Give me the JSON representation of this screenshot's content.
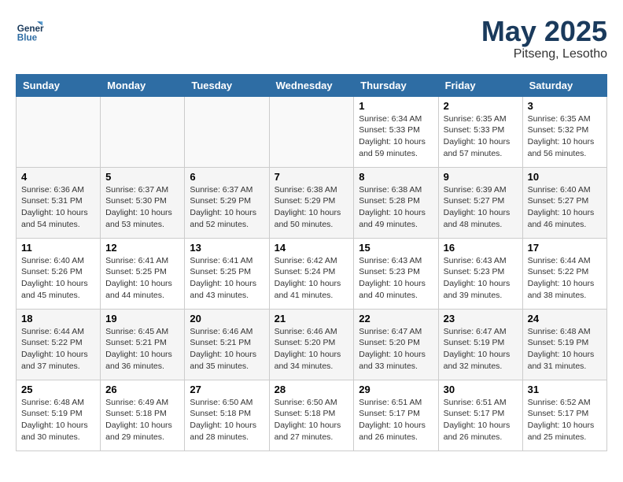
{
  "logo": {
    "text_top": "General",
    "text_bottom": "Blue"
  },
  "header": {
    "month_year": "May 2025",
    "location": "Pitseng, Lesotho"
  },
  "days_of_week": [
    "Sunday",
    "Monday",
    "Tuesday",
    "Wednesday",
    "Thursday",
    "Friday",
    "Saturday"
  ],
  "weeks": [
    [
      {
        "num": "",
        "sunrise": "",
        "sunset": "",
        "daylight": ""
      },
      {
        "num": "",
        "sunrise": "",
        "sunset": "",
        "daylight": ""
      },
      {
        "num": "",
        "sunrise": "",
        "sunset": "",
        "daylight": ""
      },
      {
        "num": "",
        "sunrise": "",
        "sunset": "",
        "daylight": ""
      },
      {
        "num": "1",
        "sunrise": "Sunrise: 6:34 AM",
        "sunset": "Sunset: 5:33 PM",
        "daylight": "Daylight: 10 hours and 59 minutes."
      },
      {
        "num": "2",
        "sunrise": "Sunrise: 6:35 AM",
        "sunset": "Sunset: 5:33 PM",
        "daylight": "Daylight: 10 hours and 57 minutes."
      },
      {
        "num": "3",
        "sunrise": "Sunrise: 6:35 AM",
        "sunset": "Sunset: 5:32 PM",
        "daylight": "Daylight: 10 hours and 56 minutes."
      }
    ],
    [
      {
        "num": "4",
        "sunrise": "Sunrise: 6:36 AM",
        "sunset": "Sunset: 5:31 PM",
        "daylight": "Daylight: 10 hours and 54 minutes."
      },
      {
        "num": "5",
        "sunrise": "Sunrise: 6:37 AM",
        "sunset": "Sunset: 5:30 PM",
        "daylight": "Daylight: 10 hours and 53 minutes."
      },
      {
        "num": "6",
        "sunrise": "Sunrise: 6:37 AM",
        "sunset": "Sunset: 5:29 PM",
        "daylight": "Daylight: 10 hours and 52 minutes."
      },
      {
        "num": "7",
        "sunrise": "Sunrise: 6:38 AM",
        "sunset": "Sunset: 5:29 PM",
        "daylight": "Daylight: 10 hours and 50 minutes."
      },
      {
        "num": "8",
        "sunrise": "Sunrise: 6:38 AM",
        "sunset": "Sunset: 5:28 PM",
        "daylight": "Daylight: 10 hours and 49 minutes."
      },
      {
        "num": "9",
        "sunrise": "Sunrise: 6:39 AM",
        "sunset": "Sunset: 5:27 PM",
        "daylight": "Daylight: 10 hours and 48 minutes."
      },
      {
        "num": "10",
        "sunrise": "Sunrise: 6:40 AM",
        "sunset": "Sunset: 5:27 PM",
        "daylight": "Daylight: 10 hours and 46 minutes."
      }
    ],
    [
      {
        "num": "11",
        "sunrise": "Sunrise: 6:40 AM",
        "sunset": "Sunset: 5:26 PM",
        "daylight": "Daylight: 10 hours and 45 minutes."
      },
      {
        "num": "12",
        "sunrise": "Sunrise: 6:41 AM",
        "sunset": "Sunset: 5:25 PM",
        "daylight": "Daylight: 10 hours and 44 minutes."
      },
      {
        "num": "13",
        "sunrise": "Sunrise: 6:41 AM",
        "sunset": "Sunset: 5:25 PM",
        "daylight": "Daylight: 10 hours and 43 minutes."
      },
      {
        "num": "14",
        "sunrise": "Sunrise: 6:42 AM",
        "sunset": "Sunset: 5:24 PM",
        "daylight": "Daylight: 10 hours and 41 minutes."
      },
      {
        "num": "15",
        "sunrise": "Sunrise: 6:43 AM",
        "sunset": "Sunset: 5:23 PM",
        "daylight": "Daylight: 10 hours and 40 minutes."
      },
      {
        "num": "16",
        "sunrise": "Sunrise: 6:43 AM",
        "sunset": "Sunset: 5:23 PM",
        "daylight": "Daylight: 10 hours and 39 minutes."
      },
      {
        "num": "17",
        "sunrise": "Sunrise: 6:44 AM",
        "sunset": "Sunset: 5:22 PM",
        "daylight": "Daylight: 10 hours and 38 minutes."
      }
    ],
    [
      {
        "num": "18",
        "sunrise": "Sunrise: 6:44 AM",
        "sunset": "Sunset: 5:22 PM",
        "daylight": "Daylight: 10 hours and 37 minutes."
      },
      {
        "num": "19",
        "sunrise": "Sunrise: 6:45 AM",
        "sunset": "Sunset: 5:21 PM",
        "daylight": "Daylight: 10 hours and 36 minutes."
      },
      {
        "num": "20",
        "sunrise": "Sunrise: 6:46 AM",
        "sunset": "Sunset: 5:21 PM",
        "daylight": "Daylight: 10 hours and 35 minutes."
      },
      {
        "num": "21",
        "sunrise": "Sunrise: 6:46 AM",
        "sunset": "Sunset: 5:20 PM",
        "daylight": "Daylight: 10 hours and 34 minutes."
      },
      {
        "num": "22",
        "sunrise": "Sunrise: 6:47 AM",
        "sunset": "Sunset: 5:20 PM",
        "daylight": "Daylight: 10 hours and 33 minutes."
      },
      {
        "num": "23",
        "sunrise": "Sunrise: 6:47 AM",
        "sunset": "Sunset: 5:19 PM",
        "daylight": "Daylight: 10 hours and 32 minutes."
      },
      {
        "num": "24",
        "sunrise": "Sunrise: 6:48 AM",
        "sunset": "Sunset: 5:19 PM",
        "daylight": "Daylight: 10 hours and 31 minutes."
      }
    ],
    [
      {
        "num": "25",
        "sunrise": "Sunrise: 6:48 AM",
        "sunset": "Sunset: 5:19 PM",
        "daylight": "Daylight: 10 hours and 30 minutes."
      },
      {
        "num": "26",
        "sunrise": "Sunrise: 6:49 AM",
        "sunset": "Sunset: 5:18 PM",
        "daylight": "Daylight: 10 hours and 29 minutes."
      },
      {
        "num": "27",
        "sunrise": "Sunrise: 6:50 AM",
        "sunset": "Sunset: 5:18 PM",
        "daylight": "Daylight: 10 hours and 28 minutes."
      },
      {
        "num": "28",
        "sunrise": "Sunrise: 6:50 AM",
        "sunset": "Sunset: 5:18 PM",
        "daylight": "Daylight: 10 hours and 27 minutes."
      },
      {
        "num": "29",
        "sunrise": "Sunrise: 6:51 AM",
        "sunset": "Sunset: 5:17 PM",
        "daylight": "Daylight: 10 hours and 26 minutes."
      },
      {
        "num": "30",
        "sunrise": "Sunrise: 6:51 AM",
        "sunset": "Sunset: 5:17 PM",
        "daylight": "Daylight: 10 hours and 26 minutes."
      },
      {
        "num": "31",
        "sunrise": "Sunrise: 6:52 AM",
        "sunset": "Sunset: 5:17 PM",
        "daylight": "Daylight: 10 hours and 25 minutes."
      }
    ]
  ]
}
